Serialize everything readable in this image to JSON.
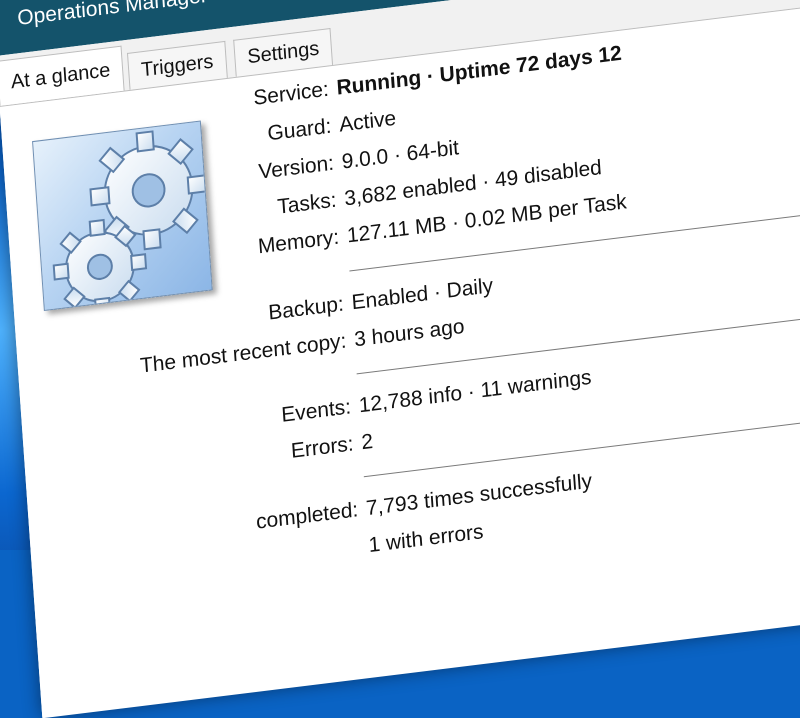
{
  "window": {
    "title": "Operations Manager"
  },
  "tabs": [
    {
      "label": "At a glance",
      "active": true
    },
    {
      "label": "Triggers",
      "active": false
    },
    {
      "label": "Settings",
      "active": false
    }
  ],
  "glance": {
    "service": {
      "label": "Service:",
      "value": "Running · Uptime 72 days 12"
    },
    "guard": {
      "label": "Guard:",
      "value": "Active"
    },
    "version": {
      "label": "Version:",
      "value": "9.0.0 · 64-bit"
    },
    "tasks": {
      "label": "Tasks:",
      "value": "3,682 enabled · 49 disabled"
    },
    "memory": {
      "label": "Memory:",
      "value": "127.11 MB · 0.02 MB per Task"
    },
    "backup": {
      "label": "Backup:",
      "value": "Enabled · Daily"
    },
    "recent_copy": {
      "label": "The most recent copy:",
      "value": "3 hours ago"
    },
    "events": {
      "label": "Events:",
      "value": "12,788 info · 11 warnings"
    },
    "errors": {
      "label": "Errors:",
      "value": "2"
    },
    "completed": {
      "label": "completed:",
      "value": "7,793 times successfully"
    },
    "with_errors": {
      "value": "1 with errors"
    }
  },
  "colors": {
    "titlebar": "#14536b",
    "desktop": "#0b67d0"
  },
  "icons": {
    "app_logo": "gears-icon"
  }
}
